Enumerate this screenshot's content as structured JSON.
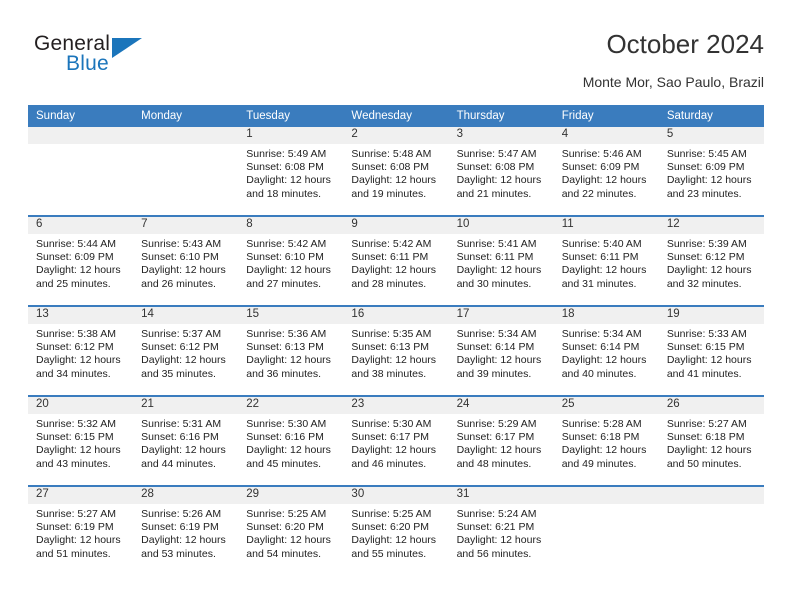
{
  "brand": {
    "name_top": "General",
    "name_bottom": "Blue",
    "triangle_icon": "blue-triangle-icon",
    "color_dark": "#231f20",
    "color_blue": "#1b75bb"
  },
  "header": {
    "title": "October 2024",
    "subtitle": "Monte Mor, Sao Paulo, Brazil"
  },
  "theme": {
    "header_blue": "#3a7cbe",
    "band_gray": "#f0f0f0",
    "text": "#222222"
  },
  "calendar": {
    "weekday_headers": [
      "Sunday",
      "Monday",
      "Tuesday",
      "Wednesday",
      "Thursday",
      "Friday",
      "Saturday"
    ],
    "weeks": [
      [
        {
          "empty": true
        },
        {
          "empty": true
        },
        {
          "day": "1",
          "sunrise": "Sunrise: 5:49 AM",
          "sunset": "Sunset: 6:08 PM",
          "daylight": "Daylight: 12 hours and 18 minutes."
        },
        {
          "day": "2",
          "sunrise": "Sunrise: 5:48 AM",
          "sunset": "Sunset: 6:08 PM",
          "daylight": "Daylight: 12 hours and 19 minutes."
        },
        {
          "day": "3",
          "sunrise": "Sunrise: 5:47 AM",
          "sunset": "Sunset: 6:08 PM",
          "daylight": "Daylight: 12 hours and 21 minutes."
        },
        {
          "day": "4",
          "sunrise": "Sunrise: 5:46 AM",
          "sunset": "Sunset: 6:09 PM",
          "daylight": "Daylight: 12 hours and 22 minutes."
        },
        {
          "day": "5",
          "sunrise": "Sunrise: 5:45 AM",
          "sunset": "Sunset: 6:09 PM",
          "daylight": "Daylight: 12 hours and 23 minutes."
        }
      ],
      [
        {
          "day": "6",
          "sunrise": "Sunrise: 5:44 AM",
          "sunset": "Sunset: 6:09 PM",
          "daylight": "Daylight: 12 hours and 25 minutes."
        },
        {
          "day": "7",
          "sunrise": "Sunrise: 5:43 AM",
          "sunset": "Sunset: 6:10 PM",
          "daylight": "Daylight: 12 hours and 26 minutes."
        },
        {
          "day": "8",
          "sunrise": "Sunrise: 5:42 AM",
          "sunset": "Sunset: 6:10 PM",
          "daylight": "Daylight: 12 hours and 27 minutes."
        },
        {
          "day": "9",
          "sunrise": "Sunrise: 5:42 AM",
          "sunset": "Sunset: 6:11 PM",
          "daylight": "Daylight: 12 hours and 28 minutes."
        },
        {
          "day": "10",
          "sunrise": "Sunrise: 5:41 AM",
          "sunset": "Sunset: 6:11 PM",
          "daylight": "Daylight: 12 hours and 30 minutes."
        },
        {
          "day": "11",
          "sunrise": "Sunrise: 5:40 AM",
          "sunset": "Sunset: 6:11 PM",
          "daylight": "Daylight: 12 hours and 31 minutes."
        },
        {
          "day": "12",
          "sunrise": "Sunrise: 5:39 AM",
          "sunset": "Sunset: 6:12 PM",
          "daylight": "Daylight: 12 hours and 32 minutes."
        }
      ],
      [
        {
          "day": "13",
          "sunrise": "Sunrise: 5:38 AM",
          "sunset": "Sunset: 6:12 PM",
          "daylight": "Daylight: 12 hours and 34 minutes."
        },
        {
          "day": "14",
          "sunrise": "Sunrise: 5:37 AM",
          "sunset": "Sunset: 6:12 PM",
          "daylight": "Daylight: 12 hours and 35 minutes."
        },
        {
          "day": "15",
          "sunrise": "Sunrise: 5:36 AM",
          "sunset": "Sunset: 6:13 PM",
          "daylight": "Daylight: 12 hours and 36 minutes."
        },
        {
          "day": "16",
          "sunrise": "Sunrise: 5:35 AM",
          "sunset": "Sunset: 6:13 PM",
          "daylight": "Daylight: 12 hours and 38 minutes."
        },
        {
          "day": "17",
          "sunrise": "Sunrise: 5:34 AM",
          "sunset": "Sunset: 6:14 PM",
          "daylight": "Daylight: 12 hours and 39 minutes."
        },
        {
          "day": "18",
          "sunrise": "Sunrise: 5:34 AM",
          "sunset": "Sunset: 6:14 PM",
          "daylight": "Daylight: 12 hours and 40 minutes."
        },
        {
          "day": "19",
          "sunrise": "Sunrise: 5:33 AM",
          "sunset": "Sunset: 6:15 PM",
          "daylight": "Daylight: 12 hours and 41 minutes."
        }
      ],
      [
        {
          "day": "20",
          "sunrise": "Sunrise: 5:32 AM",
          "sunset": "Sunset: 6:15 PM",
          "daylight": "Daylight: 12 hours and 43 minutes."
        },
        {
          "day": "21",
          "sunrise": "Sunrise: 5:31 AM",
          "sunset": "Sunset: 6:16 PM",
          "daylight": "Daylight: 12 hours and 44 minutes."
        },
        {
          "day": "22",
          "sunrise": "Sunrise: 5:30 AM",
          "sunset": "Sunset: 6:16 PM",
          "daylight": "Daylight: 12 hours and 45 minutes."
        },
        {
          "day": "23",
          "sunrise": "Sunrise: 5:30 AM",
          "sunset": "Sunset: 6:17 PM",
          "daylight": "Daylight: 12 hours and 46 minutes."
        },
        {
          "day": "24",
          "sunrise": "Sunrise: 5:29 AM",
          "sunset": "Sunset: 6:17 PM",
          "daylight": "Daylight: 12 hours and 48 minutes."
        },
        {
          "day": "25",
          "sunrise": "Sunrise: 5:28 AM",
          "sunset": "Sunset: 6:18 PM",
          "daylight": "Daylight: 12 hours and 49 minutes."
        },
        {
          "day": "26",
          "sunrise": "Sunrise: 5:27 AM",
          "sunset": "Sunset: 6:18 PM",
          "daylight": "Daylight: 12 hours and 50 minutes."
        }
      ],
      [
        {
          "day": "27",
          "sunrise": "Sunrise: 5:27 AM",
          "sunset": "Sunset: 6:19 PM",
          "daylight": "Daylight: 12 hours and 51 minutes."
        },
        {
          "day": "28",
          "sunrise": "Sunrise: 5:26 AM",
          "sunset": "Sunset: 6:19 PM",
          "daylight": "Daylight: 12 hours and 53 minutes."
        },
        {
          "day": "29",
          "sunrise": "Sunrise: 5:25 AM",
          "sunset": "Sunset: 6:20 PM",
          "daylight": "Daylight: 12 hours and 54 minutes."
        },
        {
          "day": "30",
          "sunrise": "Sunrise: 5:25 AM",
          "sunset": "Sunset: 6:20 PM",
          "daylight": "Daylight: 12 hours and 55 minutes."
        },
        {
          "day": "31",
          "sunrise": "Sunrise: 5:24 AM",
          "sunset": "Sunset: 6:21 PM",
          "daylight": "Daylight: 12 hours and 56 minutes."
        },
        {
          "empty": true
        },
        {
          "empty": true
        }
      ]
    ]
  }
}
